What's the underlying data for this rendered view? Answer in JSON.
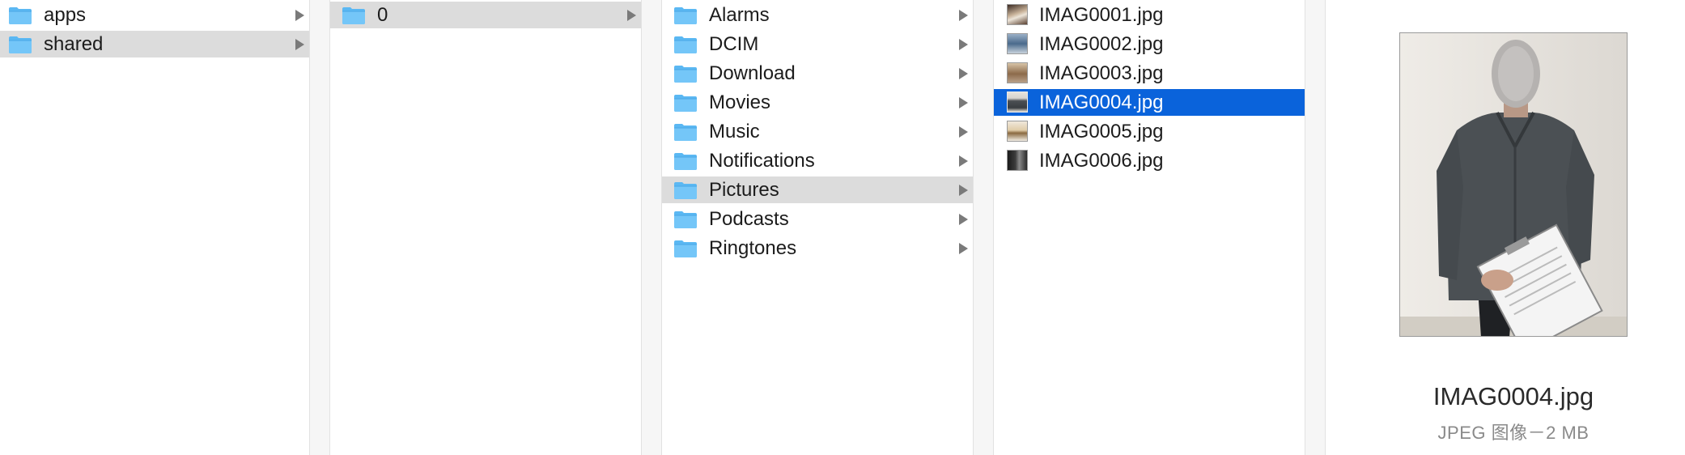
{
  "columns": {
    "col1": {
      "items": [
        {
          "label": "apps",
          "selected": false
        },
        {
          "label": "shared",
          "selected": true
        }
      ]
    },
    "col2": {
      "items": [
        {
          "label": "0",
          "selected": true
        }
      ]
    },
    "col3": {
      "items": [
        {
          "label": "Alarms"
        },
        {
          "label": "DCIM"
        },
        {
          "label": "Download"
        },
        {
          "label": "Movies"
        },
        {
          "label": "Music"
        },
        {
          "label": "Notifications"
        },
        {
          "label": "Pictures",
          "selected": true
        },
        {
          "label": "Podcasts"
        },
        {
          "label": "Ringtones"
        }
      ]
    },
    "col4": {
      "items": [
        {
          "label": "IMAG0001.jpg"
        },
        {
          "label": "IMAG0002.jpg"
        },
        {
          "label": "IMAG0003.jpg"
        },
        {
          "label": "IMAG0004.jpg",
          "selected": true
        },
        {
          "label": "IMAG0005.jpg"
        },
        {
          "label": "IMAG0006.jpg"
        }
      ]
    }
  },
  "preview": {
    "file_name": "IMAG0004.jpg",
    "meta": "JPEG 图像－2 MB"
  },
  "colors": {
    "folder": "#5bb8f3",
    "selection_active": "#0a63db",
    "selection_inactive": "#dcdcdc"
  }
}
